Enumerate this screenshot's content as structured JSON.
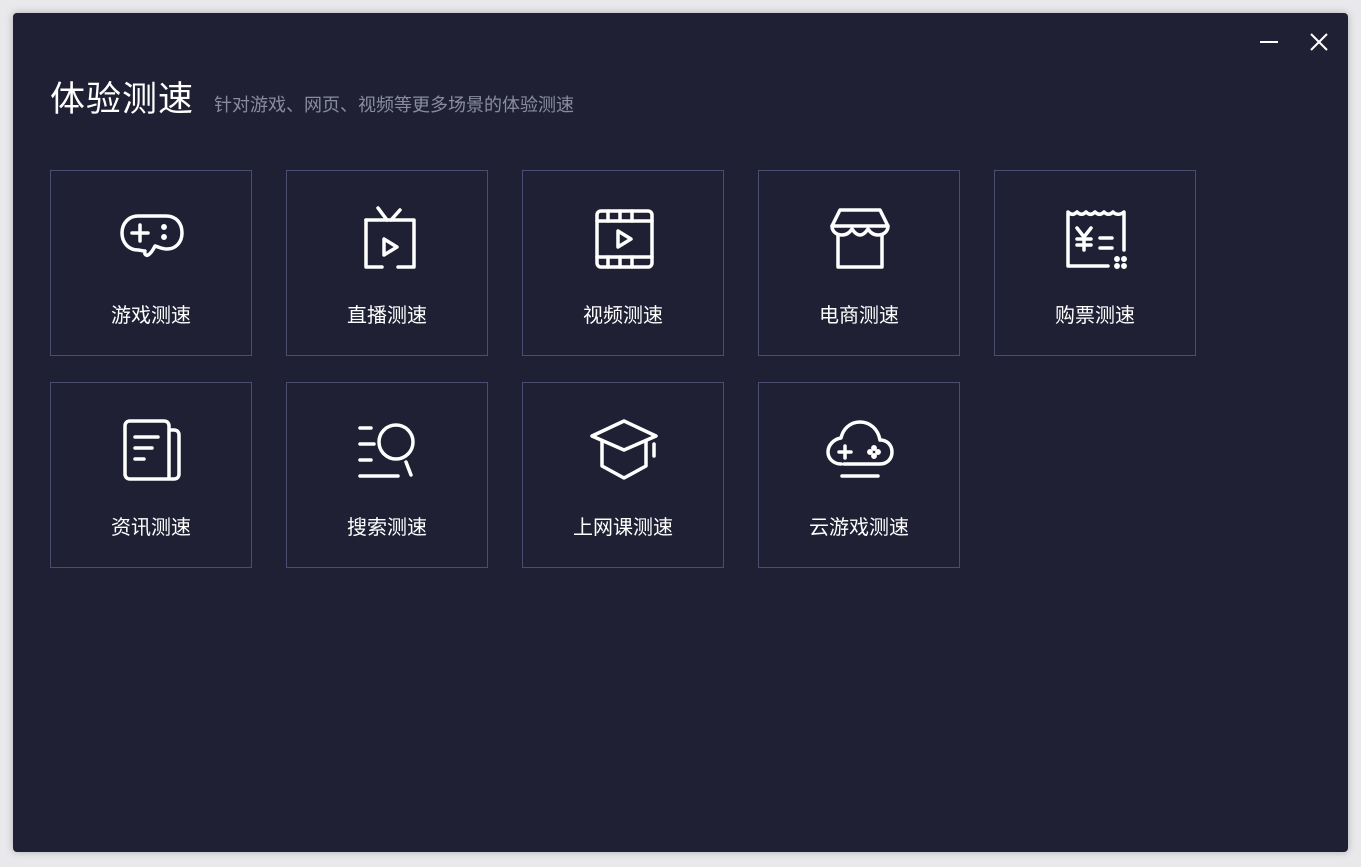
{
  "window": {
    "title": "体验测速",
    "subtitle": "针对游戏、网页、视频等更多场景的体验测速",
    "controls": {
      "minimize_icon": "minimize-icon",
      "close_icon": "close-icon"
    }
  },
  "tiles": [
    {
      "label": "游戏测速",
      "icon": "gamepad-icon"
    },
    {
      "label": "直播测速",
      "icon": "tv-play-icon"
    },
    {
      "label": "视频测速",
      "icon": "film-icon"
    },
    {
      "label": "电商测速",
      "icon": "store-icon"
    },
    {
      "label": "购票测速",
      "icon": "ticket-icon"
    },
    {
      "label": "资讯测速",
      "icon": "news-icon"
    },
    {
      "label": "搜索测速",
      "icon": "search-list-icon"
    },
    {
      "label": "上网课测速",
      "icon": "graduation-cap-icon"
    },
    {
      "label": "云游戏测速",
      "icon": "cloud-game-icon"
    }
  ],
  "colors": {
    "background": "#1f2034",
    "tile_border": "#4c4e71",
    "text": "#ffffff",
    "subtitle": "#8a8c9e"
  }
}
